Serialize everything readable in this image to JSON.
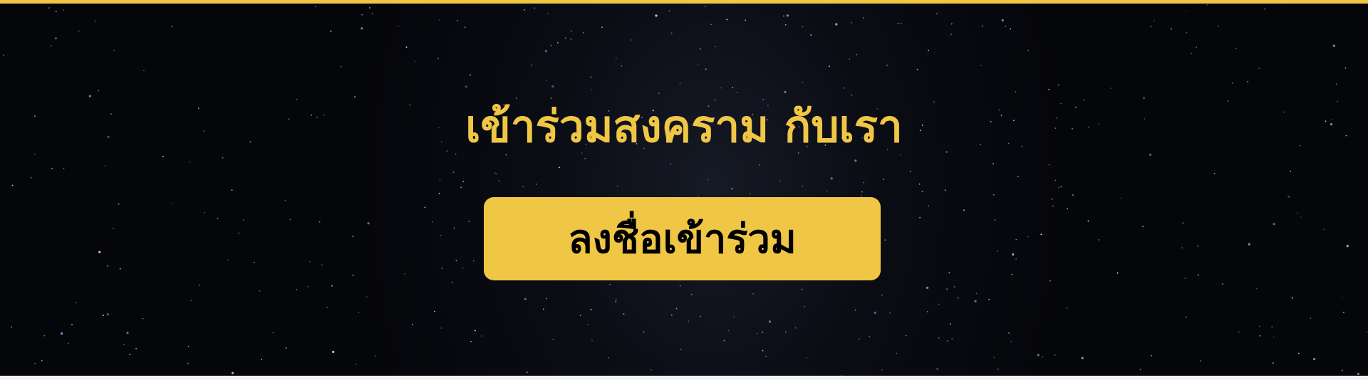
{
  "banner": {
    "title": "เข้าร่วมสงคราม กับเรา",
    "cta_label": "ลงชื่อเข้าร่วม"
  },
  "colors": {
    "accent": "#f0c645",
    "background": "#05060a",
    "button_text": "#000000"
  }
}
